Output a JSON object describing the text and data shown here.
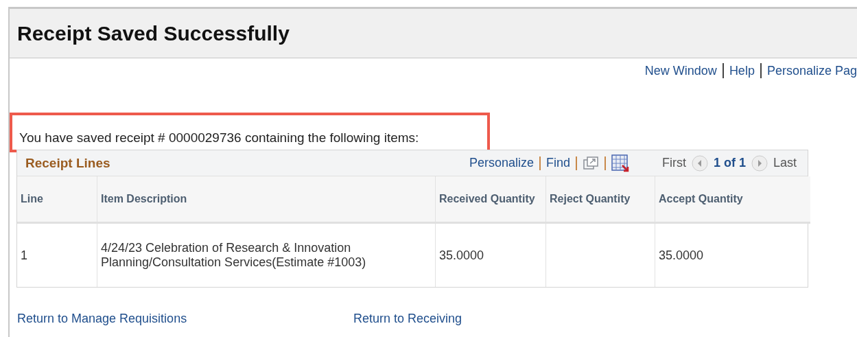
{
  "page_title": "Receipt Saved Successfully",
  "top_links": [
    "New Window",
    "Help",
    "Personalize Pag"
  ],
  "message": "You have saved receipt # 0000029736 containing the following items:",
  "grid": {
    "title": "Receipt Lines",
    "toolbar_links": [
      "Personalize",
      "Find"
    ],
    "nav": {
      "first": "First",
      "counter": "1 of 1",
      "last": "Last"
    },
    "columns": [
      "Line",
      "Item Description",
      "Received Quantity",
      "Reject Quantity",
      "Accept Quantity"
    ],
    "rows": [
      [
        "1",
        "4/24/23 Celebration of Research & Innovation Planning/Consultation Services(Estimate #1003)",
        "35.0000",
        "",
        "35.0000"
      ]
    ]
  },
  "bottom_links": [
    "Return to Manage Requisitions",
    "Return to Receiving"
  ]
}
